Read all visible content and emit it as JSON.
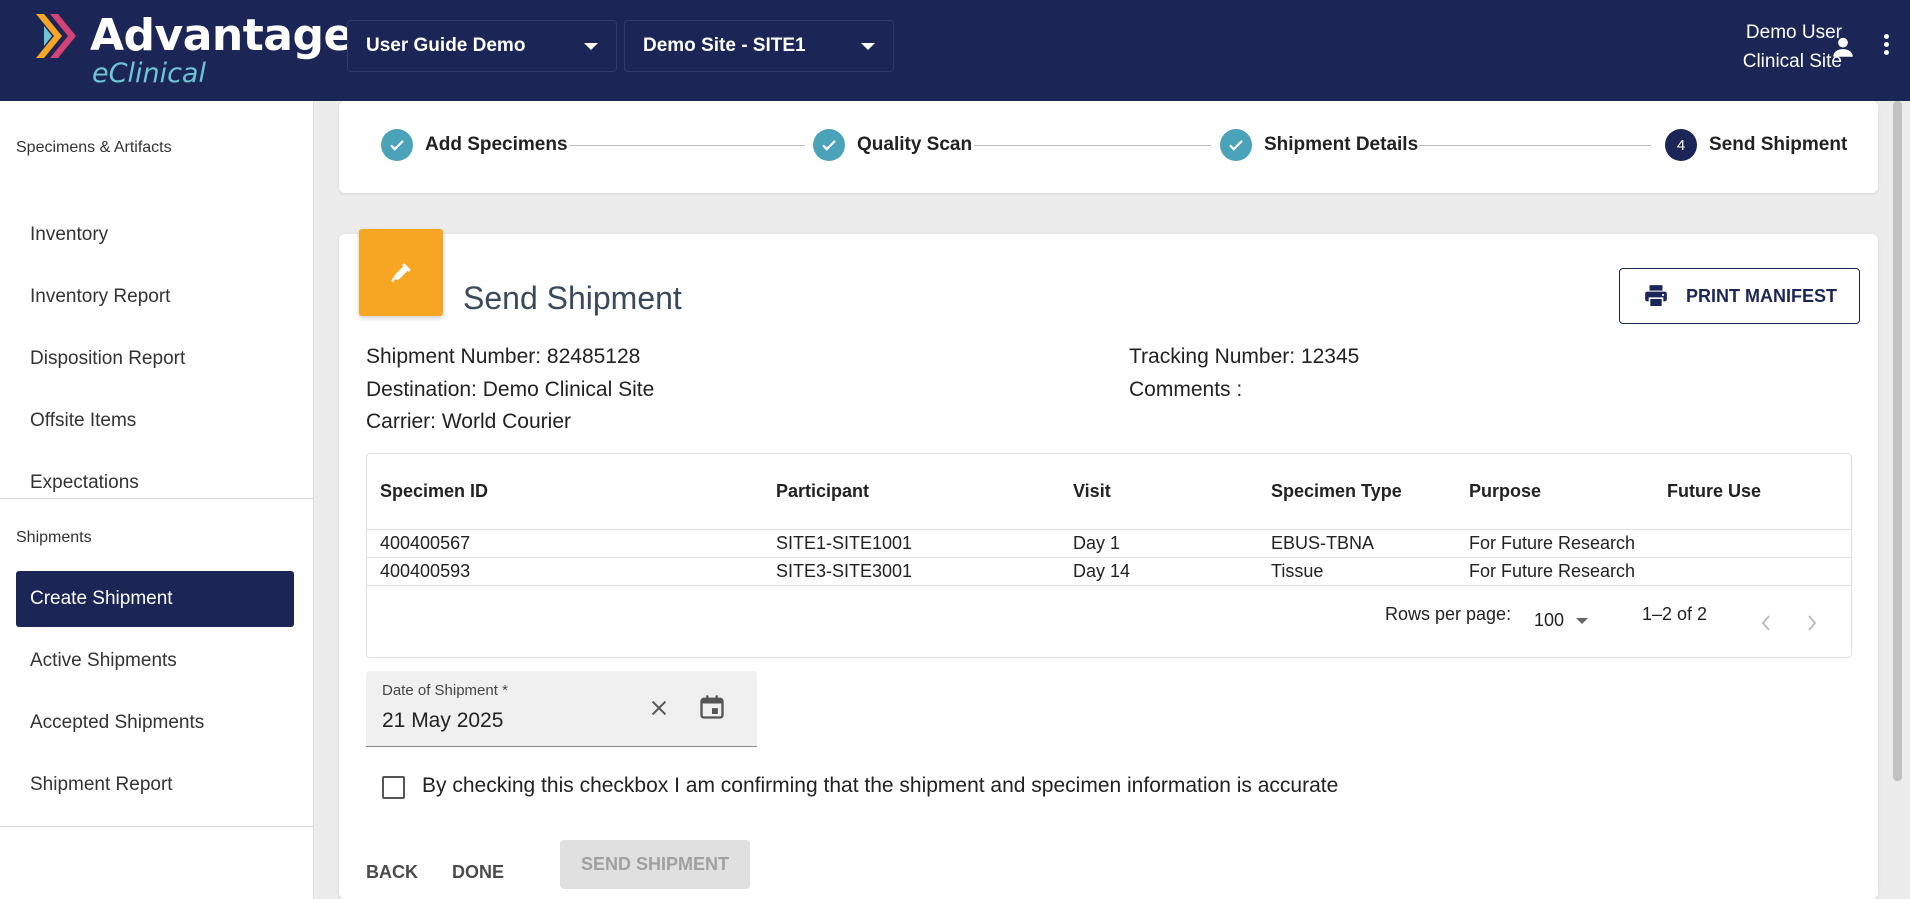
{
  "header": {
    "logo_title": "Advantage",
    "logo_subtitle": "eClinical",
    "study_select": "User Guide Demo",
    "site_select": "Demo Site - SITE1",
    "user_name": "Demo User",
    "user_role": "Clinical Site"
  },
  "sidebar": {
    "section1": "Specimens & Artifacts",
    "items1": [
      "Inventory",
      "Inventory Report",
      "Disposition Report",
      "Offsite Items",
      "Expectations"
    ],
    "section2": "Shipments",
    "items2": [
      "Create Shipment",
      "Active Shipments",
      "Accepted Shipments",
      "Shipment Report"
    ],
    "active_item": "Create Shipment"
  },
  "stepper": {
    "steps": [
      "Add Specimens",
      "Quality Scan",
      "Shipment Details",
      "Send Shipment"
    ],
    "current_step_number": "4"
  },
  "card": {
    "title": "Send Shipment",
    "print_button": "PRINT MANIFEST",
    "shipment_number": "Shipment Number: 82485128",
    "destination": "Destination: Demo Clinical Site",
    "carrier": "Carrier: World Courier",
    "tracking_number": "Tracking Number: 12345",
    "comments": "Comments :"
  },
  "table": {
    "headers": [
      "Specimen ID",
      "Participant",
      "Visit",
      "Specimen Type",
      "Purpose",
      "Future Use"
    ],
    "rows": [
      [
        "400400567",
        "SITE1-SITE1001",
        "Day 1",
        "EBUS-TBNA",
        "For Future Research",
        ""
      ],
      [
        "400400593",
        "SITE3-SITE3001",
        "Day 14",
        "Tissue",
        "For Future Research",
        ""
      ]
    ],
    "rows_per_page_label": "Rows per page:",
    "rows_per_page_value": "100",
    "page_range": "1–2 of 2"
  },
  "date_field": {
    "label": "Date of Shipment *",
    "value": "21 May 2025"
  },
  "confirm_checkbox": {
    "label": "By checking this checkbox I am confirming that the shipment and specimen information is accurate",
    "checked": false
  },
  "actions": {
    "back": "BACK",
    "done": "DONE",
    "send": "SEND SHIPMENT"
  },
  "colors": {
    "header_bg": "#1b2656",
    "accent_teal": "#4aa3b8",
    "icon_orange": "#f6a623"
  }
}
